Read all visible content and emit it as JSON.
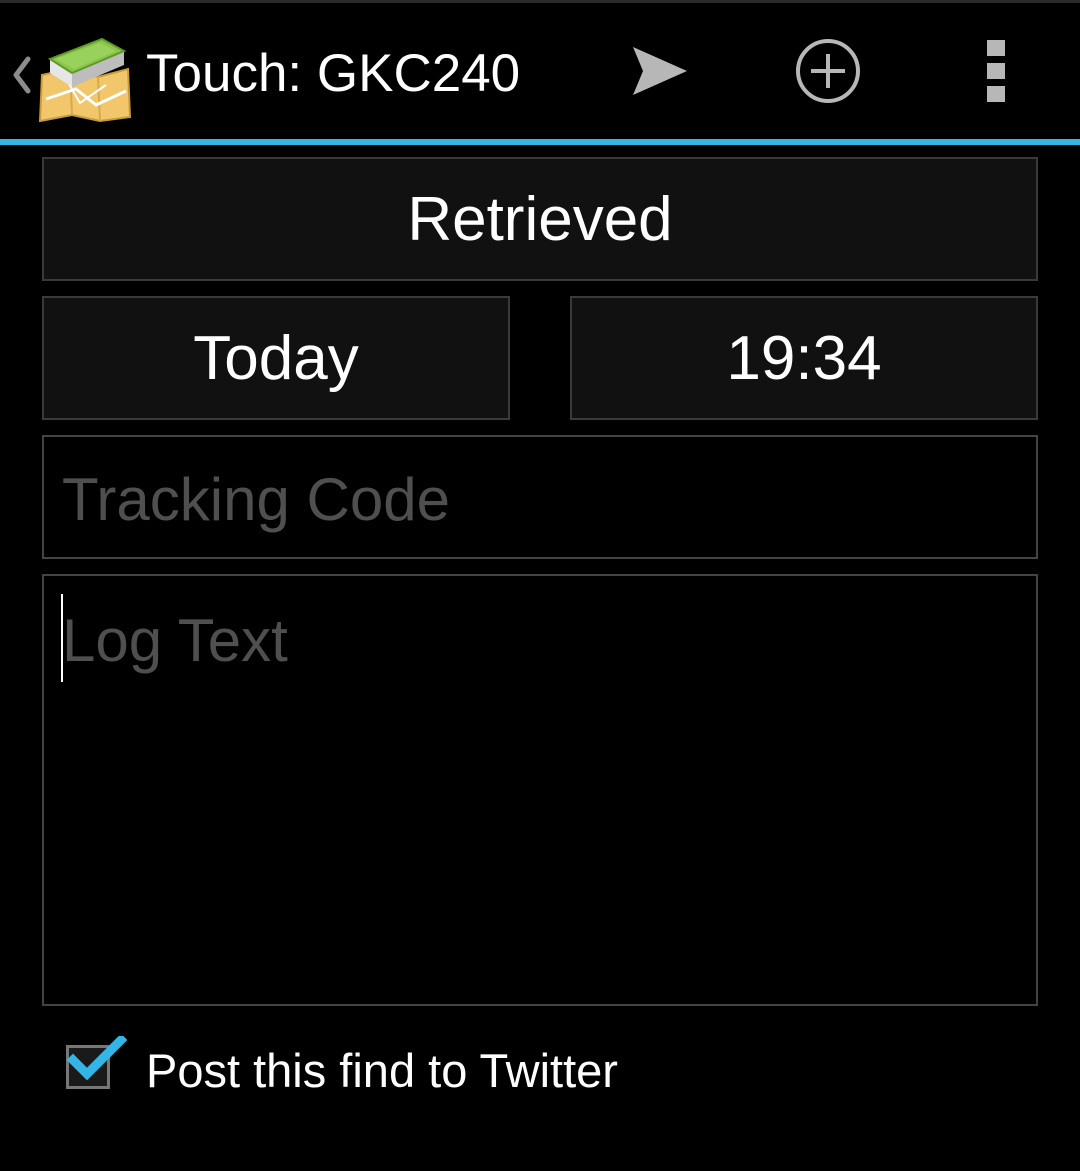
{
  "action_bar": {
    "title": "Touch: GKC240",
    "back_icon": "chevron-left-icon",
    "app_icon": "map-book-icon",
    "actions": [
      {
        "name": "send",
        "icon": "send-icon"
      },
      {
        "name": "add",
        "icon": "add-circle-icon"
      },
      {
        "name": "overflow",
        "icon": "overflow-menu-icon"
      }
    ],
    "accent_color": "#33b5e5"
  },
  "form": {
    "log_type": "Retrieved",
    "date": "Today",
    "time": "19:34",
    "tracking_code_placeholder": "Tracking Code",
    "log_text_placeholder": "Log Text",
    "post_to_twitter": {
      "label": "Post this find to Twitter",
      "checked": true
    }
  }
}
